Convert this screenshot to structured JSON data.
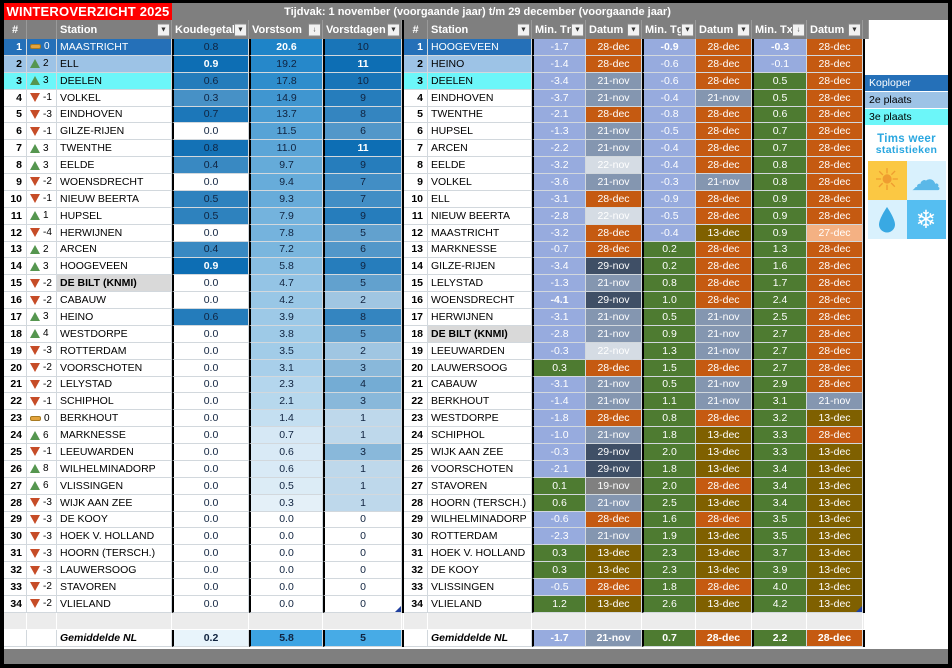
{
  "title": "WINTEROVERZICHT 2025",
  "period": "Tijdvak: 1 november (voorgaande jaar) t/m 29 december (voorgaande jaar)",
  "left_table": {
    "headers": [
      {
        "label": "#",
        "btn": null
      },
      {
        "label": "",
        "btn": null
      },
      {
        "label": "Station",
        "btn": "filter"
      },
      {
        "label": "Koudegetal",
        "btn": "filter",
        "thick": true
      },
      {
        "label": "Vorstsom",
        "btn": "sort",
        "thick": true
      },
      {
        "label": "Vorstdagen",
        "btn": "filter",
        "thick": true
      }
    ],
    "rows": [
      {
        "r": "1",
        "t": "same",
        "c": "0",
        "s": "MAASTRICHT",
        "k": "0.8",
        "v": "20.6",
        "d": "10",
        "hl": 1,
        "b": [
          "v"
        ]
      },
      {
        "r": "2",
        "t": "up",
        "c": "2",
        "s": "ELL",
        "k": "0.9",
        "v": "19.2",
        "d": "11",
        "hl": 2,
        "b": [
          "k",
          "d"
        ]
      },
      {
        "r": "3",
        "t": "up",
        "c": "3",
        "s": "DEELEN",
        "k": "0.6",
        "v": "17.8",
        "d": "10",
        "hl": 3
      },
      {
        "r": "4",
        "t": "down",
        "c": "-1",
        "s": "VOLKEL",
        "k": "0.3",
        "v": "14.9",
        "d": "9"
      },
      {
        "r": "5",
        "t": "down",
        "c": "-3",
        "s": "EINDHOVEN",
        "k": "0.7",
        "v": "13.7",
        "d": "8"
      },
      {
        "r": "6",
        "t": "down",
        "c": "-1",
        "s": "GILZE-RIJEN",
        "k": "0.0",
        "v": "11.5",
        "d": "6"
      },
      {
        "r": "7",
        "t": "up",
        "c": "3",
        "s": "TWENTHE",
        "k": "0.8",
        "v": "11.0",
        "d": "11",
        "b": [
          "d"
        ]
      },
      {
        "r": "8",
        "t": "up",
        "c": "3",
        "s": "EELDE",
        "k": "0.4",
        "v": "9.7",
        "d": "9"
      },
      {
        "r": "9",
        "t": "down",
        "c": "-2",
        "s": "WOENSDRECHT",
        "k": "0.0",
        "v": "9.4",
        "d": "7"
      },
      {
        "r": "10",
        "t": "down",
        "c": "-1",
        "s": "NIEUW BEERTA",
        "k": "0.5",
        "v": "9.3",
        "d": "7"
      },
      {
        "r": "11",
        "t": "up",
        "c": "1",
        "s": "HUPSEL",
        "k": "0.5",
        "v": "7.9",
        "d": "9"
      },
      {
        "r": "12",
        "t": "down",
        "c": "-4",
        "s": "HERWIJNEN",
        "k": "0.0",
        "v": "7.8",
        "d": "5"
      },
      {
        "r": "13",
        "t": "up",
        "c": "2",
        "s": "ARCEN",
        "k": "0.4",
        "v": "7.2",
        "d": "6"
      },
      {
        "r": "14",
        "t": "up",
        "c": "3",
        "s": "HOOGEVEEN",
        "k": "0.9",
        "v": "5.8",
        "d": "9",
        "b": [
          "k"
        ]
      },
      {
        "r": "15",
        "t": "down",
        "c": "-2",
        "s": "DE BILT (KNMI)",
        "k": "0.0",
        "v": "4.7",
        "d": "5",
        "hl": "e"
      },
      {
        "r": "16",
        "t": "down",
        "c": "-2",
        "s": "CABAUW",
        "k": "0.0",
        "v": "4.2",
        "d": "2"
      },
      {
        "r": "17",
        "t": "up",
        "c": "3",
        "s": "HEINO",
        "k": "0.6",
        "v": "3.9",
        "d": "8"
      },
      {
        "r": "18",
        "t": "up",
        "c": "4",
        "s": "WESTDORPE",
        "k": "0.0",
        "v": "3.8",
        "d": "5"
      },
      {
        "r": "19",
        "t": "down",
        "c": "-3",
        "s": "ROTTERDAM",
        "k": "0.0",
        "v": "3.5",
        "d": "2"
      },
      {
        "r": "20",
        "t": "down",
        "c": "-2",
        "s": "VOORSCHOTEN",
        "k": "0.0",
        "v": "3.1",
        "d": "3"
      },
      {
        "r": "21",
        "t": "down",
        "c": "-2",
        "s": "LELYSTAD",
        "k": "0.0",
        "v": "2.3",
        "d": "4"
      },
      {
        "r": "22",
        "t": "down",
        "c": "-1",
        "s": "SCHIPHOL",
        "k": "0.0",
        "v": "2.1",
        "d": "3"
      },
      {
        "r": "23",
        "t": "same",
        "c": "0",
        "s": "BERKHOUT",
        "k": "0.0",
        "v": "1.4",
        "d": "1"
      },
      {
        "r": "24",
        "t": "up",
        "c": "6",
        "s": "MARKNESSE",
        "k": "0.0",
        "v": "0.7",
        "d": "1"
      },
      {
        "r": "25",
        "t": "down",
        "c": "-1",
        "s": "LEEUWARDEN",
        "k": "0.0",
        "v": "0.6",
        "d": "3"
      },
      {
        "r": "26",
        "t": "up",
        "c": "8",
        "s": "WILHELMINADORP",
        "k": "0.0",
        "v": "0.6",
        "d": "1"
      },
      {
        "r": "27",
        "t": "up",
        "c": "6",
        "s": "VLISSINGEN",
        "k": "0.0",
        "v": "0.5",
        "d": "1"
      },
      {
        "r": "28",
        "t": "down",
        "c": "-3",
        "s": "WIJK AAN ZEE",
        "k": "0.0",
        "v": "0.3",
        "d": "1"
      },
      {
        "r": "29",
        "t": "down",
        "c": "-3",
        "s": "DE KOOY",
        "k": "0.0",
        "v": "0.0",
        "d": "0"
      },
      {
        "r": "30",
        "t": "down",
        "c": "-3",
        "s": "HOEK V. HOLLAND",
        "k": "0.0",
        "v": "0.0",
        "d": "0"
      },
      {
        "r": "31",
        "t": "down",
        "c": "-3",
        "s": "HOORN (TERSCH.)",
        "k": "0.0",
        "v": "0.0",
        "d": "0"
      },
      {
        "r": "32",
        "t": "down",
        "c": "-3",
        "s": "LAUWERSOOG",
        "k": "0.0",
        "v": "0.0",
        "d": "0"
      },
      {
        "r": "33",
        "t": "down",
        "c": "-2",
        "s": "STAVOREN",
        "k": "0.0",
        "v": "0.0",
        "d": "0"
      },
      {
        "r": "34",
        "t": "down",
        "c": "-2",
        "s": "VLIELAND",
        "k": "0.0",
        "v": "0.0",
        "d": "0",
        "flag": "d"
      }
    ],
    "footer": {
      "label": "Gemiddelde NL",
      "k": "0.2",
      "v": "5.8",
      "d": "5"
    }
  },
  "right_table": {
    "headers": [
      {
        "label": "#",
        "btn": null
      },
      {
        "label": "Station",
        "btn": "filter"
      },
      {
        "label": "Min. Tn",
        "btn": "filter",
        "thick": true
      },
      {
        "label": "Datum",
        "btn": "filter"
      },
      {
        "label": "Min. Tg",
        "btn": "filter",
        "thick": true
      },
      {
        "label": "Datum",
        "btn": "filter"
      },
      {
        "label": "Min. Tx",
        "btn": "sort",
        "thick": true
      },
      {
        "label": "Datum",
        "btn": "filter"
      }
    ],
    "rows": [
      {
        "r": "1",
        "s": "HOOGEVEEN",
        "tn": "-1.7",
        "tnd": "28-dec",
        "tg": "-0.9",
        "tgd": "28-dec",
        "tx": "-0.3",
        "txd": "28-dec",
        "hl": 1,
        "b": [
          "tg",
          "tx"
        ]
      },
      {
        "r": "2",
        "s": "HEINO",
        "tn": "-1.4",
        "tnd": "28-dec",
        "tg": "-0.6",
        "tgd": "28-dec",
        "tx": "-0.1",
        "txd": "28-dec",
        "hl": 2
      },
      {
        "r": "3",
        "s": "DEELEN",
        "tn": "-3.4",
        "tnd": "21-nov",
        "tg": "-0.6",
        "tgd": "28-dec",
        "tx": "0.5",
        "txd": "28-dec",
        "hl": 3
      },
      {
        "r": "4",
        "s": "EINDHOVEN",
        "tn": "-3.7",
        "tnd": "21-nov",
        "tg": "-0.4",
        "tgd": "21-nov",
        "tx": "0.5",
        "txd": "28-dec"
      },
      {
        "r": "5",
        "s": "TWENTHE",
        "tn": "-2.1",
        "tnd": "28-dec",
        "tg": "-0.8",
        "tgd": "28-dec",
        "tx": "0.6",
        "txd": "28-dec"
      },
      {
        "r": "6",
        "s": "HUPSEL",
        "tn": "-1.3",
        "tnd": "21-nov",
        "tg": "-0.5",
        "tgd": "28-dec",
        "tx": "0.7",
        "txd": "28-dec"
      },
      {
        "r": "7",
        "s": "ARCEN",
        "tn": "-2.2",
        "tnd": "21-nov",
        "tg": "-0.4",
        "tgd": "28-dec",
        "tx": "0.7",
        "txd": "28-dec"
      },
      {
        "r": "8",
        "s": "EELDE",
        "tn": "-3.2",
        "tnd": "22-nov",
        "tg": "-0.4",
        "tgd": "28-dec",
        "tx": "0.8",
        "txd": "28-dec"
      },
      {
        "r": "9",
        "s": "VOLKEL",
        "tn": "-3.6",
        "tnd": "21-nov",
        "tg": "-0.3",
        "tgd": "21-nov",
        "tx": "0.8",
        "txd": "28-dec"
      },
      {
        "r": "10",
        "s": "ELL",
        "tn": "-3.1",
        "tnd": "28-dec",
        "tg": "-0.9",
        "tgd": "28-dec",
        "tx": "0.9",
        "txd": "28-dec"
      },
      {
        "r": "11",
        "s": "NIEUW BEERTA",
        "tn": "-2.8",
        "tnd": "22-nov",
        "tg": "-0.5",
        "tgd": "28-dec",
        "tx": "0.9",
        "txd": "28-dec"
      },
      {
        "r": "12",
        "s": "MAASTRICHT",
        "tn": "-3.2",
        "tnd": "28-dec",
        "tg": "-0.4",
        "tgd": "13-dec",
        "tx": "0.9",
        "txd": "27-dec"
      },
      {
        "r": "13",
        "s": "MARKNESSE",
        "tn": "-0.7",
        "tnd": "28-dec",
        "tg": "0.2",
        "tgd": "28-dec",
        "tx": "1.3",
        "txd": "28-dec"
      },
      {
        "r": "14",
        "s": "GILZE-RIJEN",
        "tn": "-3.4",
        "tnd": "29-nov",
        "tg": "0.2",
        "tgd": "28-dec",
        "tx": "1.6",
        "txd": "28-dec"
      },
      {
        "r": "15",
        "s": "LELYSTAD",
        "tn": "-1.3",
        "tnd": "21-nov",
        "tg": "0.8",
        "tgd": "28-dec",
        "tx": "1.7",
        "txd": "28-dec"
      },
      {
        "r": "16",
        "s": "WOENSDRECHT",
        "tn": "-4.1",
        "tnd": "29-nov",
        "tg": "1.0",
        "tgd": "28-dec",
        "tx": "2.4",
        "txd": "28-dec",
        "b": [
          "tn"
        ]
      },
      {
        "r": "17",
        "s": "HERWIJNEN",
        "tn": "-3.1",
        "tnd": "21-nov",
        "tg": "0.5",
        "tgd": "21-nov",
        "tx": "2.5",
        "txd": "28-dec"
      },
      {
        "r": "18",
        "s": "DE BILT (KNMI)",
        "tn": "-2.8",
        "tnd": "21-nov",
        "tg": "0.9",
        "tgd": "21-nov",
        "tx": "2.7",
        "txd": "28-dec",
        "hl": "e"
      },
      {
        "r": "19",
        "s": "LEEUWARDEN",
        "tn": "-0.3",
        "tnd": "22-nov",
        "tg": "1.3",
        "tgd": "21-nov",
        "tx": "2.7",
        "txd": "28-dec"
      },
      {
        "r": "20",
        "s": "LAUWERSOOG",
        "tn": "0.3",
        "tnd": "28-dec",
        "tg": "1.5",
        "tgd": "28-dec",
        "tx": "2.7",
        "txd": "28-dec"
      },
      {
        "r": "21",
        "s": "CABAUW",
        "tn": "-3.1",
        "tnd": "21-nov",
        "tg": "0.5",
        "tgd": "21-nov",
        "tx": "2.9",
        "txd": "28-dec"
      },
      {
        "r": "22",
        "s": "BERKHOUT",
        "tn": "-1.4",
        "tnd": "21-nov",
        "tg": "1.1",
        "tgd": "21-nov",
        "tx": "3.1",
        "txd": "21-nov"
      },
      {
        "r": "23",
        "s": "WESTDORPE",
        "tn": "-1.8",
        "tnd": "28-dec",
        "tg": "0.8",
        "tgd": "28-dec",
        "tx": "3.2",
        "txd": "13-dec"
      },
      {
        "r": "24",
        "s": "SCHIPHOL",
        "tn": "-1.0",
        "tnd": "21-nov",
        "tg": "1.8",
        "tgd": "13-dec",
        "tx": "3.3",
        "txd": "28-dec"
      },
      {
        "r": "25",
        "s": "WIJK AAN ZEE",
        "tn": "-0.3",
        "tnd": "29-nov",
        "tg": "2.0",
        "tgd": "13-dec",
        "tx": "3.3",
        "txd": "13-dec"
      },
      {
        "r": "26",
        "s": "VOORSCHOTEN",
        "tn": "-2.1",
        "tnd": "29-nov",
        "tg": "1.8",
        "tgd": "13-dec",
        "tx": "3.4",
        "txd": "13-dec"
      },
      {
        "r": "27",
        "s": "STAVOREN",
        "tn": "0.1",
        "tnd": "19-nov",
        "tg": "2.0",
        "tgd": "28-dec",
        "tx": "3.4",
        "txd": "13-dec"
      },
      {
        "r": "28",
        "s": "HOORN (TERSCH.)",
        "tn": "0.6",
        "tnd": "21-nov",
        "tg": "2.5",
        "tgd": "13-dec",
        "tx": "3.4",
        "txd": "13-dec"
      },
      {
        "r": "29",
        "s": "WILHELMINADORP",
        "tn": "-0.6",
        "tnd": "28-dec",
        "tg": "1.6",
        "tgd": "28-dec",
        "tx": "3.5",
        "txd": "13-dec"
      },
      {
        "r": "30",
        "s": "ROTTERDAM",
        "tn": "-2.3",
        "tnd": "21-nov",
        "tg": "1.9",
        "tgd": "13-dec",
        "tx": "3.5",
        "txd": "13-dec"
      },
      {
        "r": "31",
        "s": "HOEK V. HOLLAND",
        "tn": "0.3",
        "tnd": "13-dec",
        "tg": "2.3",
        "tgd": "13-dec",
        "tx": "3.7",
        "txd": "13-dec"
      },
      {
        "r": "32",
        "s": "DE KOOY",
        "tn": "0.3",
        "tnd": "13-dec",
        "tg": "2.3",
        "tgd": "13-dec",
        "tx": "3.9",
        "txd": "13-dec"
      },
      {
        "r": "33",
        "s": "VLISSINGEN",
        "tn": "-0.5",
        "tnd": "28-dec",
        "tg": "1.8",
        "tgd": "28-dec",
        "tx": "4.0",
        "txd": "13-dec"
      },
      {
        "r": "34",
        "s": "VLIELAND",
        "tn": "1.2",
        "tnd": "13-dec",
        "tg": "2.6",
        "tgd": "13-dec",
        "tx": "4.2",
        "txd": "13-dec",
        "flag": "txd"
      }
    ],
    "footer": {
      "label": "Gemiddelde NL",
      "tn": "-1.7",
      "tnd": "21-nov",
      "tg": "0.7",
      "tgd": "28-dec",
      "tx": "2.2",
      "txd": "28-dec",
      "b": [
        "tg",
        "tx"
      ]
    }
  },
  "legend": {
    "items": [
      {
        "label": "Koploper",
        "color": "#2570b8",
        "text": "#ffffff"
      },
      {
        "label": "2e plaats",
        "color": "#9dc3e6",
        "text": "#000000"
      },
      {
        "label": "3e plaats",
        "color": "#6cf6f9",
        "text": "#000000"
      }
    ],
    "logo": {
      "line1": "Tims weer",
      "line2": "statistieken",
      "icons": [
        "sun-icon",
        "cloud-icon",
        "raindrop-icon",
        "snowflake-icon"
      ]
    }
  },
  "colors": {
    "title_red": "#fe0000",
    "header_gray": "#7f7f7f",
    "rank_first": "#2570b8",
    "rank_second": "#9dc3e6",
    "rank_third": "#6cf6f9",
    "emphasis": "#d9d9d9",
    "scale_koudegetal_max": "#0d6eb4",
    "scale_vorstsom_max": "#1e84c8",
    "scale_vorstdagen_max": "#0d6eb4",
    "neg_temp": "#97abde",
    "pos_temp": "#4e7b31",
    "dates": {
      "28-dec": "#c55a11",
      "21-nov": "#8496b0",
      "22-nov": "#d5dce4",
      "29-nov": "#3f4f66",
      "13-dec": "#7f6000",
      "27-dec": "#f4b183",
      "19-nov": "#808080"
    },
    "footer_left": {
      "k": "#e8f4fb",
      "v": "#3da4e3",
      "d": "#47abe6"
    },
    "trend_up": "#55964f",
    "trend_down": "#c64c27",
    "trend_same": "#e3a33c"
  }
}
